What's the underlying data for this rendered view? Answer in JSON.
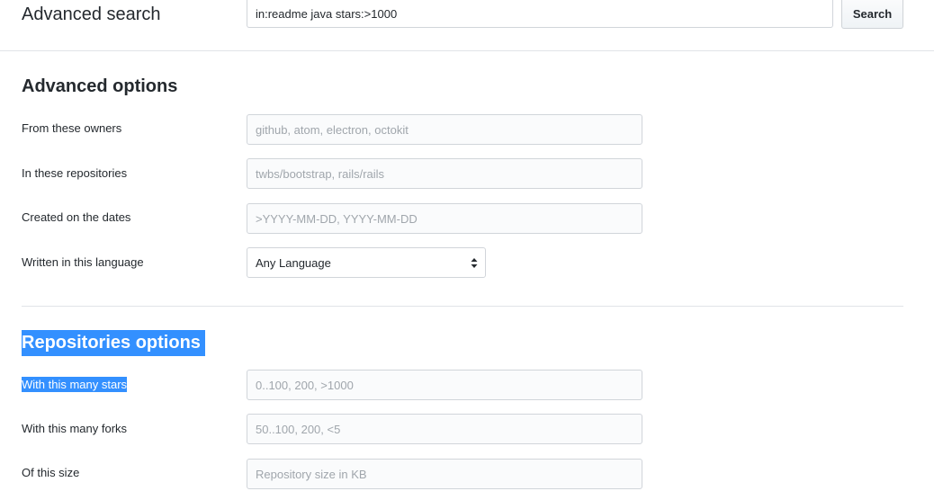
{
  "header": {
    "title": "Advanced search",
    "query_value": "in:readme java stars:>1000",
    "search_label": "Search"
  },
  "advanced_options": {
    "title": "Advanced options",
    "fields": [
      {
        "label": "From these owners",
        "placeholder": "github, atom, electron, octokit"
      },
      {
        "label": "In these repositories",
        "placeholder": "twbs/bootstrap, rails/rails"
      },
      {
        "label": "Created on the dates",
        "placeholder": ">YYYY-MM-DD, YYYY-MM-DD"
      }
    ],
    "language": {
      "label": "Written in this language",
      "selected": "Any Language"
    }
  },
  "repositories_options": {
    "title": "Repositories options",
    "fields": [
      {
        "label": "With this many stars",
        "placeholder": "0..100, 200, >1000"
      },
      {
        "label": "With this many forks",
        "placeholder": "50..100, 200, <5"
      },
      {
        "label": "Of this size",
        "placeholder": "Repository size in KB"
      }
    ]
  },
  "colors": {
    "selection": "#3390ff",
    "border": "#d1d5da",
    "text": "#24292e",
    "placeholder": "#a0a6ac"
  },
  "icons": {
    "select_chevron": "select-updown-icon"
  }
}
